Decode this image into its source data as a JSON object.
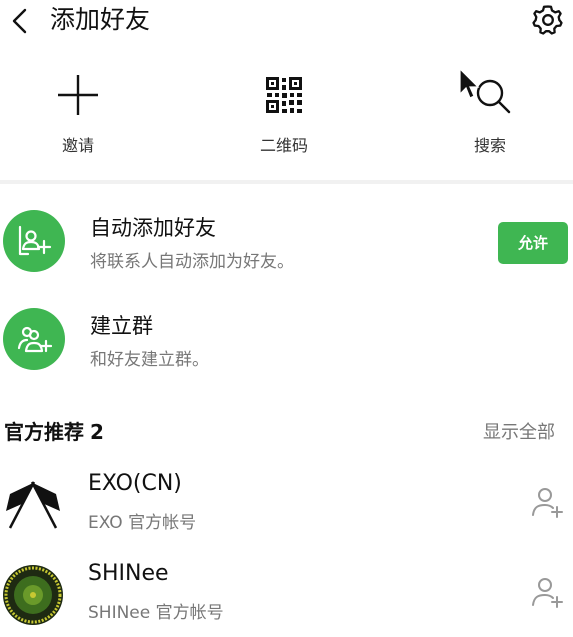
{
  "header": {
    "title": "添加好友"
  },
  "actions": [
    {
      "label": "邀请",
      "icon": "plus-icon"
    },
    {
      "label": "二维码",
      "icon": "qr-code-icon"
    },
    {
      "label": "搜索",
      "icon": "search-icon"
    }
  ],
  "auto_add": {
    "title": "自动添加好友",
    "subtitle": "将联系人自动添加为好友。",
    "button": "允许",
    "icon": "add-contact-icon"
  },
  "create_group": {
    "title": "建立群",
    "subtitle": "和好友建立群。",
    "icon": "add-group-icon"
  },
  "recommend": {
    "title": "官方推荐",
    "count": "2",
    "show_all": "显示全部",
    "accounts": [
      {
        "name": "EXO(CN)",
        "subtitle": "EXO 官方帐号"
      },
      {
        "name": "SHINee",
        "subtitle": "SHINee 官方帐号"
      }
    ]
  },
  "colors": {
    "accent": "#3fb652",
    "text": "#111111",
    "muted": "#777777"
  }
}
